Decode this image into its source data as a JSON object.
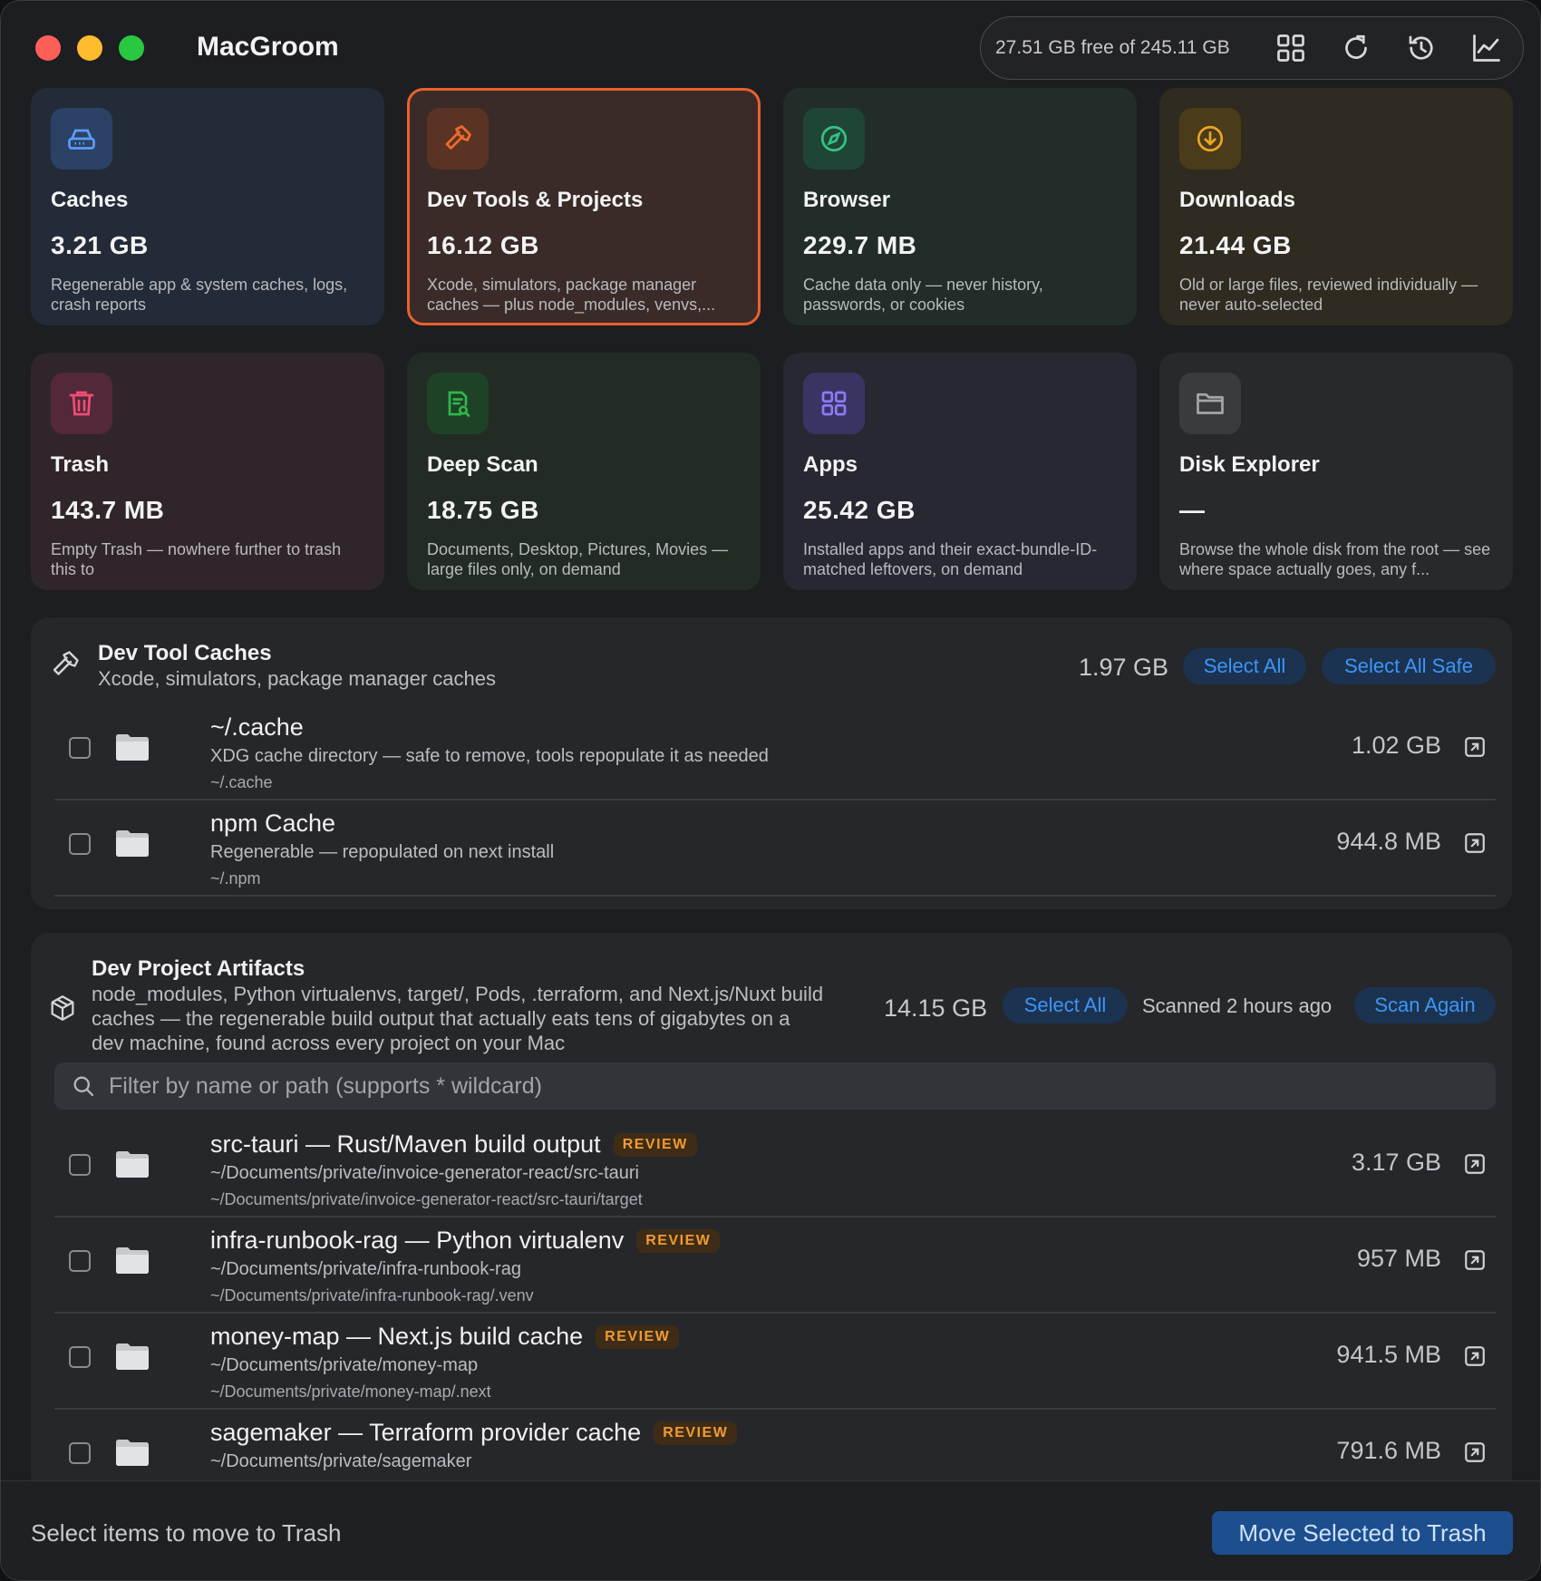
{
  "app": {
    "title": "MacGroom",
    "disk_free": "27.51 GB free of 245.11 GB",
    "toolbar_icons": [
      "grid-icon",
      "refresh-icon",
      "history-icon",
      "chart-icon"
    ]
  },
  "categories": [
    {
      "title": "Caches",
      "size": "3.21 GB",
      "desc": "Regenerable app & system caches, logs, crash reports",
      "icon": "drive-icon",
      "accent": "#4a8ff5"
    },
    {
      "title": "Dev Tools & Projects",
      "size": "16.12 GB",
      "desc": "Xcode, simulators, package manager caches — plus node_modules, venvs,...",
      "icon": "hammer-icon",
      "accent": "#e8622b",
      "selected": true
    },
    {
      "title": "Browser",
      "size": "229.7 MB",
      "desc": "Cache data only — never history, passwords, or cookies",
      "icon": "compass-icon",
      "accent": "#2fb57a"
    },
    {
      "title": "Downloads",
      "size": "21.44 GB",
      "desc": "Old or large files, reviewed individually — never auto-selected",
      "icon": "download-icon",
      "accent": "#e0a020"
    },
    {
      "title": "Trash",
      "size": "143.7 MB",
      "desc": "Empty Trash — nowhere further to trash this to",
      "icon": "trash-icon",
      "accent": "#e6436b"
    },
    {
      "title": "Deep Scan",
      "size": "18.75 GB",
      "desc": "Documents, Desktop, Pictures, Movies — large files only, on demand",
      "icon": "doc-search-icon",
      "accent": "#2fae4a"
    },
    {
      "title": "Apps",
      "size": "25.42 GB",
      "desc": "Installed apps and their exact-bundle-ID-matched leftovers, on demand",
      "icon": "apps-grid-icon",
      "accent": "#7b6cf0"
    },
    {
      "title": "Disk Explorer",
      "size": "—",
      "desc": "Browse the whole disk from the root — see where space actually goes, any f...",
      "icon": "folder-icon",
      "accent": "#9a9ba0"
    }
  ],
  "dev_tool_caches": {
    "title": "Dev Tool Caches",
    "subtitle": "Xcode, simulators, package manager caches",
    "total": "1.97 GB",
    "select_all": "Select All",
    "select_all_safe": "Select All Safe",
    "items": [
      {
        "name": "~/.cache",
        "desc": "XDG cache directory — safe to remove, tools repopulate it as needed",
        "path": "~/.cache",
        "size": "1.02 GB"
      },
      {
        "name": "npm Cache",
        "desc": "Regenerable — repopulated on next install",
        "path": "~/.npm",
        "size": "944.8 MB"
      }
    ]
  },
  "dev_project_artifacts": {
    "title": "Dev Project Artifacts",
    "subtitle_lines": [
      "node_modules, Python virtualenvs, target/, Pods, .terraform, and Next.js/Nuxt build",
      "caches — the regenerable build output that actually eats tens of gigabytes on a",
      "dev machine, found across every project on your Mac"
    ],
    "total": "14.15 GB",
    "select_all": "Select All",
    "scanned": "Scanned 2 hours ago",
    "scan_again": "Scan Again",
    "filter_placeholder": "Filter by name or path (supports * wildcard)",
    "badge": "REVIEW",
    "items": [
      {
        "name": "src-tauri — Rust/Maven build output",
        "project": "~/Documents/private/invoice-generator-react/src-tauri",
        "path": "~/Documents/private/invoice-generator-react/src-tauri/target",
        "size": "3.17 GB"
      },
      {
        "name": "infra-runbook-rag — Python virtualenv",
        "project": "~/Documents/private/infra-runbook-rag",
        "path": "~/Documents/private/infra-runbook-rag/.venv",
        "size": "957 MB"
      },
      {
        "name": "money-map — Next.js build cache",
        "project": "~/Documents/private/money-map",
        "path": "~/Documents/private/money-map/.next",
        "size": "941.5 MB"
      },
      {
        "name": "sagemaker — Terraform provider cache",
        "project": "~/Documents/private/sagemaker",
        "path": "",
        "size": "791.6 MB"
      }
    ]
  },
  "footer": {
    "status": "Select items to move to Trash",
    "action": "Move Selected to Trash"
  }
}
